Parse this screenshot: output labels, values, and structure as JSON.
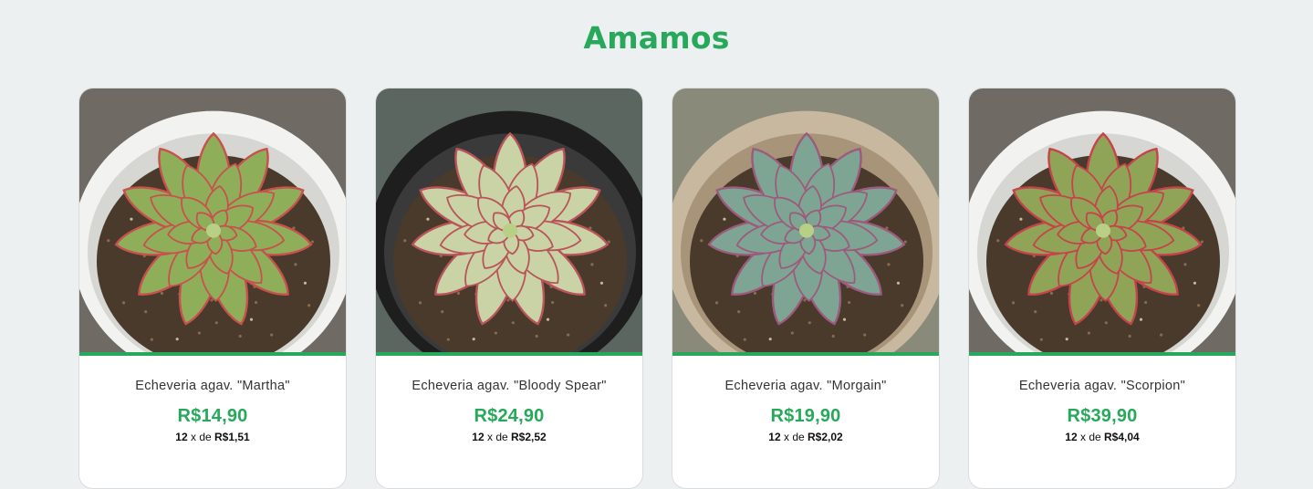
{
  "section": {
    "title": "Amamos"
  },
  "installment_connector": "x de",
  "products": [
    {
      "name": "Echeveria agav. \"Martha\"",
      "price": "R$14,90",
      "installments": "12",
      "installment_value": "R$1,51",
      "pot": "white",
      "leaf_color": "#8fae5a",
      "tip_color": "#c8504d"
    },
    {
      "name": "Echeveria agav. \"Bloody Spear\"",
      "price": "R$24,90",
      "installments": "12",
      "installment_value": "R$2,52",
      "pot": "black",
      "leaf_color": "#c9d3a5",
      "tip_color": "#b8545a"
    },
    {
      "name": "Echeveria agav. \"Morgain\"",
      "price": "R$19,90",
      "installments": "12",
      "installment_value": "R$2,02",
      "pot": "tan",
      "leaf_color": "#7ea594",
      "tip_color": "#9c5b7c"
    },
    {
      "name": "Echeveria agav. \"Scorpion\"",
      "price": "R$39,90",
      "installments": "12",
      "installment_value": "R$4,04",
      "pot": "white",
      "leaf_color": "#8fa456",
      "tip_color": "#c6434c"
    }
  ]
}
